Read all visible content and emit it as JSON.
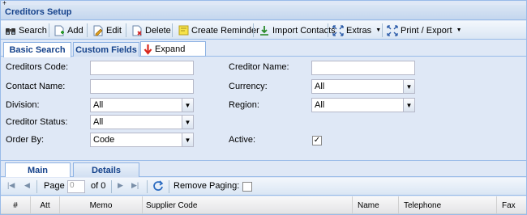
{
  "corner_mark": "‡",
  "title": "Creditors Setup",
  "toolbar": {
    "search": "Search",
    "add": "Add",
    "edit": "Edit",
    "delete": "Delete",
    "create_reminder": "Create Reminder",
    "import_contacts": "Import Contacts",
    "extras": "Extras",
    "print_export": "Print / Export"
  },
  "tabs": {
    "basic_search": "Basic Search",
    "custom_fields": "Custom Fields",
    "expand": "Expand"
  },
  "form": {
    "creditors_code_label": "Creditors Code:",
    "creditor_name_label": "Creditor Name:",
    "contact_name_label": "Contact Name:",
    "currency_label": "Currency:",
    "currency_value": "All",
    "division_label": "Division:",
    "division_value": "All",
    "region_label": "Region:",
    "region_value": "All",
    "creditor_status_label": "Creditor Status:",
    "creditor_status_value": "All",
    "order_by_label": "Order By:",
    "order_by_value": "Code",
    "active_label": "Active:",
    "active_checked": "✓"
  },
  "bottom_tabs": {
    "main": "Main",
    "details": "Details"
  },
  "pager": {
    "page_label": "Page",
    "page_value": "0",
    "of_label": "of 0",
    "remove_paging_label": "Remove Paging:"
  },
  "grid": {
    "columns": [
      "#",
      "Att",
      "Memo",
      "Supplier Code",
      "Name",
      "Telephone",
      "Fax"
    ]
  },
  "colors": {
    "header_text": "#15428b",
    "border": "#99bbe8",
    "panel_bg": "#dfe8f6"
  }
}
